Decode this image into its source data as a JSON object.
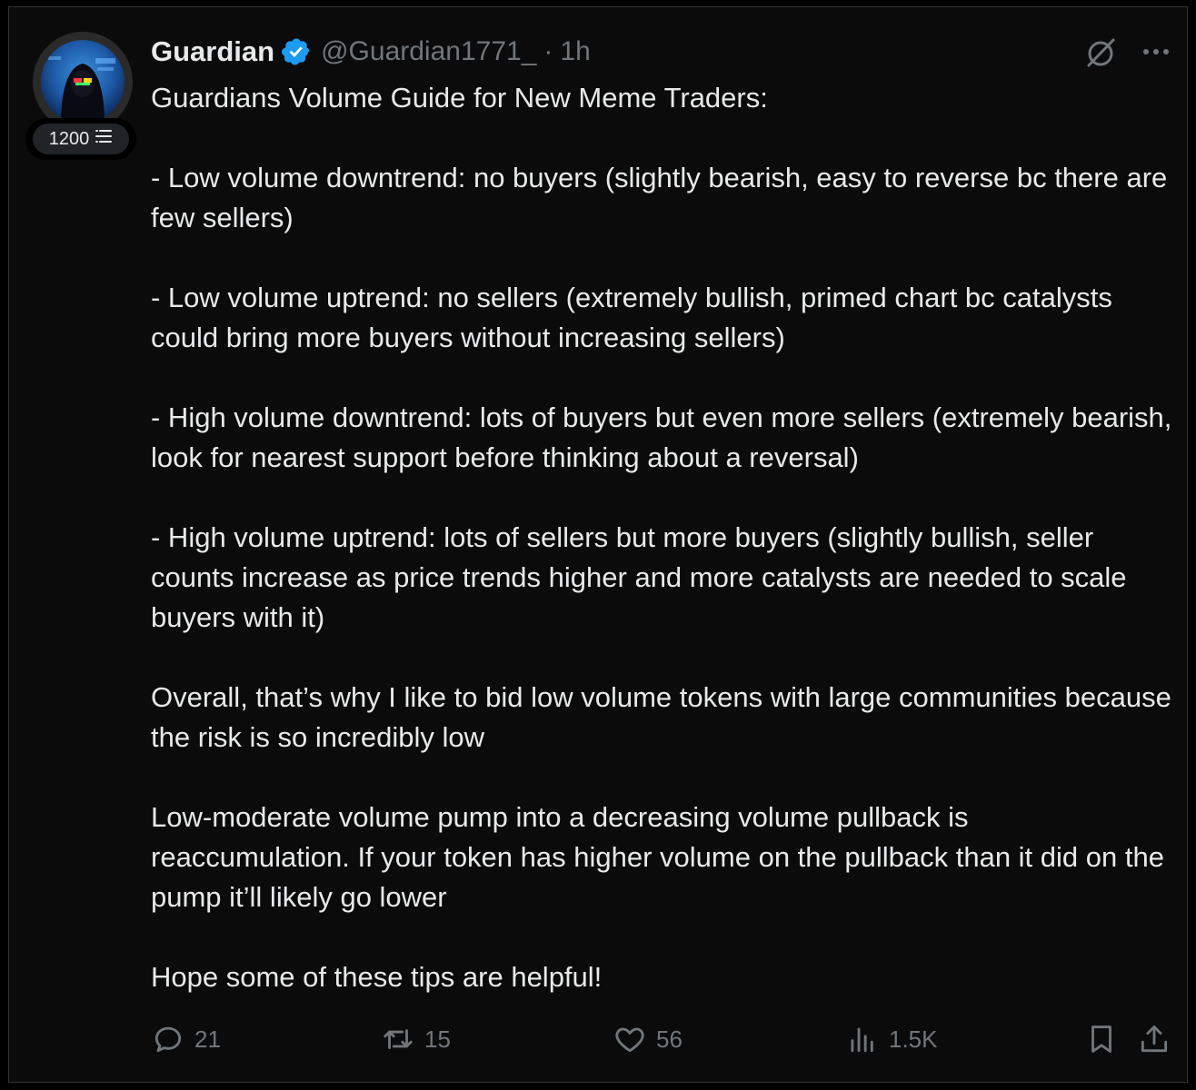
{
  "user": {
    "name": "Guardian",
    "handle": "@Guardian1771_",
    "separator": "·",
    "time": "1h",
    "badge_count": "1200"
  },
  "post": {
    "paragraphs": [
      "Guardians Volume Guide for New Meme Traders:",
      "- Low volume downtrend: no buyers (slightly bearish, easy to reverse bc there are few sellers)",
      "- Low volume uptrend: no sellers (extremely bullish, primed chart bc catalysts could bring more buyers without increasing sellers)",
      "- High volume downtrend: lots of buyers but even more sellers (extremely bearish, look for nearest support before thinking about a reversal)",
      "- High volume uptrend: lots of sellers but more buyers (slightly bullish, seller counts increase as price trends higher and more catalysts are needed to scale buyers with it)",
      "Overall, that’s why I like to bid low volume tokens with large communities because the risk is so incredibly low",
      "Low-moderate volume pump into a decreasing volume pullback is reaccumulation. If your token has higher volume on the pullback than it did on the pump it’ll likely go lower",
      "Hope some of these tips are helpful!"
    ]
  },
  "actions": {
    "replies": "21",
    "reposts": "15",
    "likes": "56",
    "views": "1.5K"
  },
  "icons": {
    "verified": "verified-badge-icon",
    "grok": "slash-circle-icon",
    "more": "more-dots-icon",
    "reply": "speech-bubble-icon",
    "repost": "repost-arrows-icon",
    "like": "heart-icon",
    "views": "bar-chart-icon",
    "bookmark": "bookmark-icon",
    "share": "share-upload-icon",
    "badge": "stacked-lines-icon"
  },
  "colors": {
    "background": "#000000",
    "card": "#0b0b0b",
    "text": "#e7e9ea",
    "muted": "#71767b",
    "verified": "#1d9bf0"
  }
}
